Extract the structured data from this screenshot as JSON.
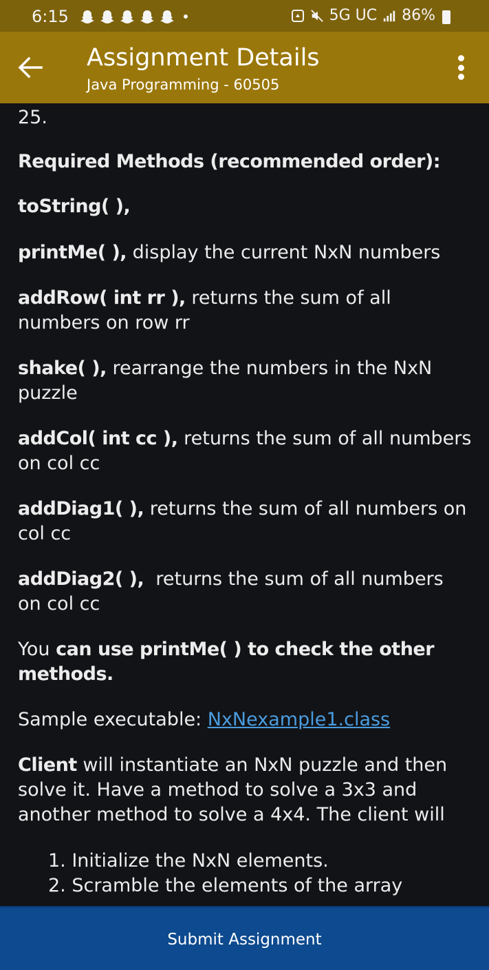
{
  "status_bar": {
    "time": "6:15",
    "network": "5G UC",
    "battery": "86%"
  },
  "app_bar": {
    "title": "Assignment Details",
    "subtitle": "Java Programming - 60505"
  },
  "content": {
    "top_fragment": "25.",
    "required_heading": "Required Methods (recommended order):",
    "methods": [
      {
        "name": "toString( ),",
        "desc": ""
      },
      {
        "name": "printMe( ),",
        "desc": " display the current NxN numbers"
      },
      {
        "name": "addRow( int rr ),",
        "desc": " returns the sum of all numbers on row rr"
      },
      {
        "name": "shake( ),",
        "desc": " rearrange the numbers in the NxN puzzle"
      },
      {
        "name": "addCol( int cc ),",
        "desc": " returns the sum of all numbers on col cc"
      },
      {
        "name": "addDiag1( ),",
        "desc": " returns the sum of all numbers on col cc"
      },
      {
        "name": "addDiag2( ),",
        "desc": "  returns the sum of all numbers on col cc"
      }
    ],
    "printme_note_prefix": "You ",
    "printme_note_bold": "can use printMe( ) to check the other methods.",
    "sample_label": "Sample executable: ",
    "sample_link": "NxNexample1.class",
    "client_bold": "Client",
    "client_text": " will instantiate an NxN puzzle and then solve it. Have a method to solve a 3x3 and another method to solve a 4x4. The client will",
    "steps": [
      "1. Initialize the NxN elements.",
      "2. Scramble the elements of the array"
    ]
  },
  "footer": {
    "submit_label": "Submit Assignment"
  }
}
